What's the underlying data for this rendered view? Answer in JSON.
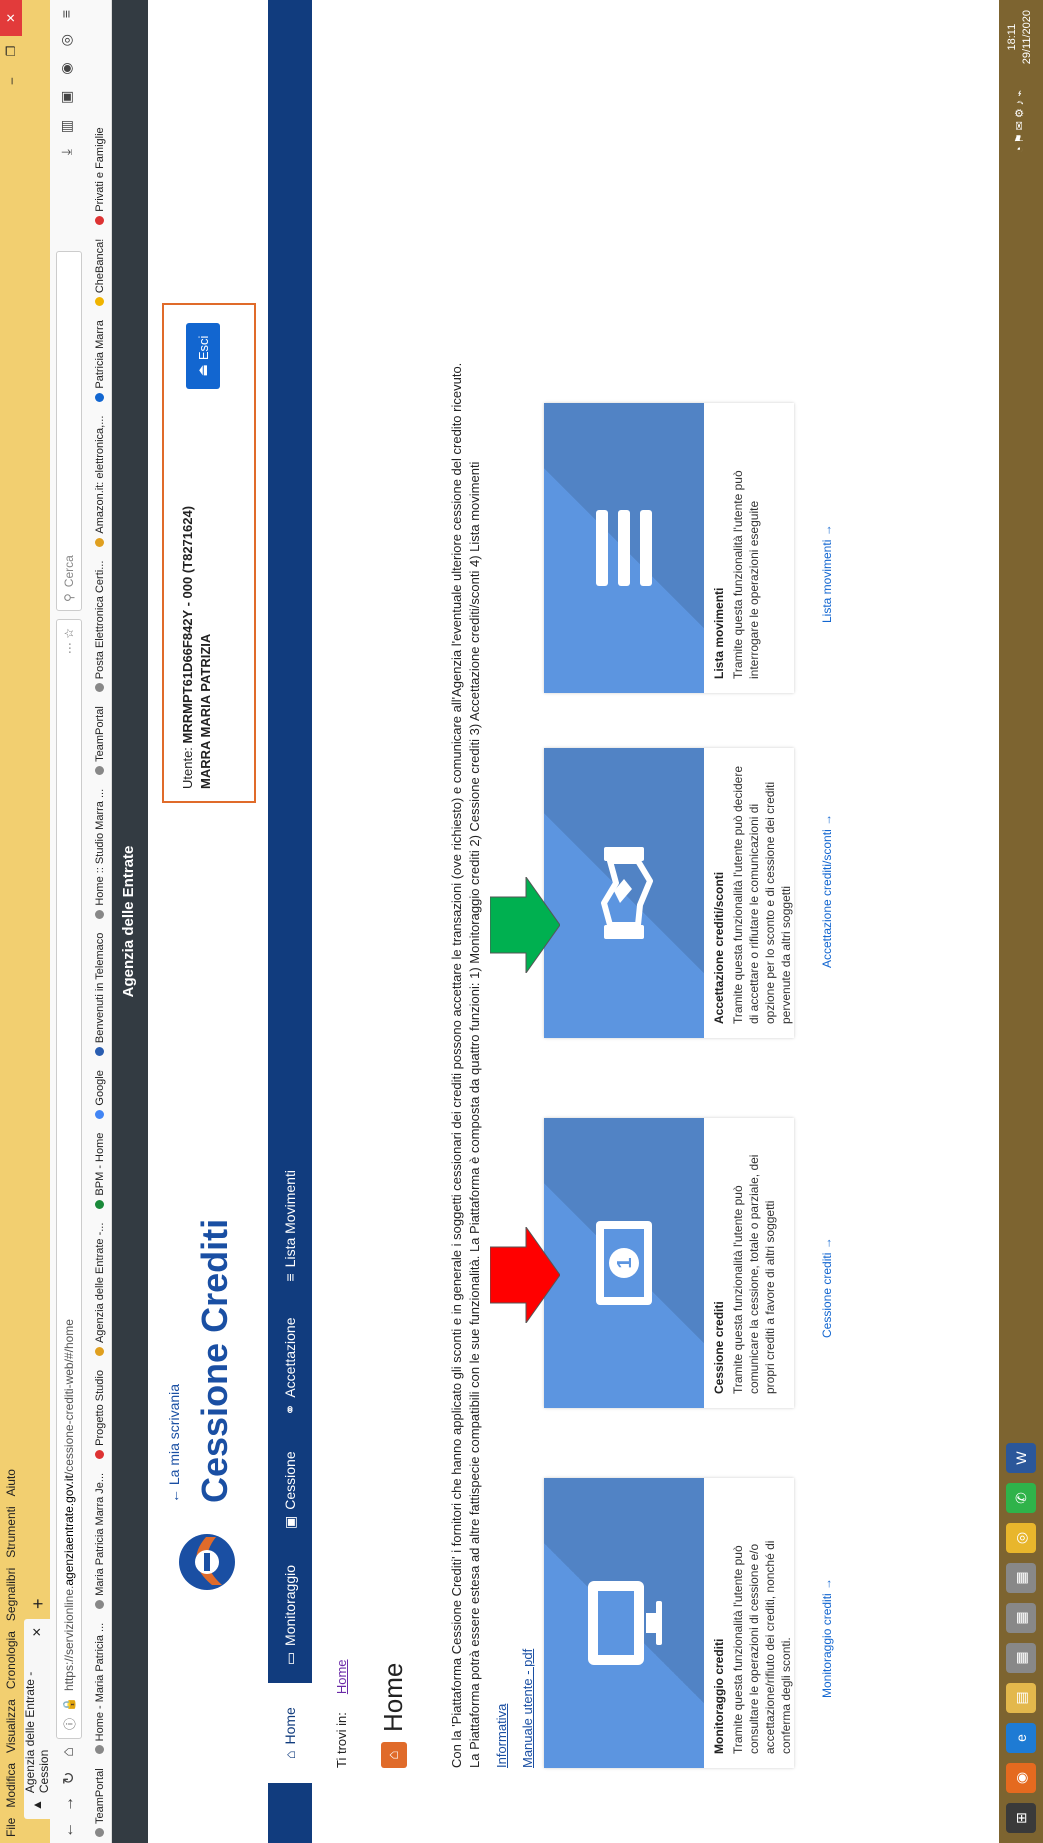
{
  "browser": {
    "menu": [
      "File",
      "Modifica",
      "Visualizza",
      "Cronologia",
      "Segnalibri",
      "Strumenti",
      "Aiuto"
    ],
    "tab_title": "Agenzia delle Entrate - Cession",
    "url_prefix": "https://servizionline.",
    "url_domain": "agenziaentrate.gov.it",
    "url_path": "/cessione-crediti-web/#/home",
    "url_dots": "··· ☆",
    "search_placeholder": "Cerca",
    "bookmarks": [
      "TeamPortal",
      "Home - Maria Patricia ...",
      "Maria Patricia Marra Je...",
      "Progetto Studio",
      "Agenzia delle Entrate -...",
      "BPM - Home",
      "Google",
      "Benvenuti in Telemaco",
      "Home :: Studio Marra ...",
      "TeamPortal",
      "Posta Elettronica Certi...",
      "Amazon.it: elettronica,...",
      "Patricia Marra",
      "CheBanca!",
      "Privati e Famiglie"
    ]
  },
  "site": {
    "top_title": "Agenzia delle Entrate",
    "back_link": "La mia scrivania",
    "title": "Cessione Crediti",
    "user_label": "Utente:",
    "user_code": "MRRMPT61D66F842Y - 000 (T8271624)",
    "user_name": "MARRA MARIA PATRIZIA",
    "logout": "Esci"
  },
  "nav": {
    "home": "Home",
    "monitoraggio": "Monitoraggio",
    "cessione": "Cessione",
    "accettazione": "Accettazione",
    "lista": "Lista Movimenti"
  },
  "content": {
    "breadcrumb_label": "Ti trovi in:",
    "breadcrumb_link": "Home",
    "heading": "Home",
    "desc1": "Con la 'Piattaforma Cessione Crediti' i fornitori che hanno applicato gli sconti e in generale i soggetti cessionari dei crediti possono accettare le transazioni (ove richiesto) e comunicare all'Agenzia l'eventuale ulteriore cessione del credito ricevuto.",
    "desc2": "La Piattaforma potrà essere estesa ad altre fattispecie compatibili con le sue funzionalità. La Piattaforma è composta da quattro funzioni: 1) Monitoraggio crediti 2) Cessione crediti 3) Accettazione crediti/sconti 4) Lista movimenti",
    "info_link": "Informativa",
    "manual_link": "Manuale utente - pdf"
  },
  "cards": [
    {
      "title": "Monitoraggio crediti",
      "desc": "Tramite questa funzionalità l'utente può consultare le operazioni di cessione e/o accettazione/rifiuto dei crediti, nonché di conferma degli sconti.",
      "link": "Monitoraggio crediti →"
    },
    {
      "title": "Cessione crediti",
      "desc": "Tramite questa funzionalità l'utente può comunicare la cessione, totale o parziale, dei propri crediti a favore di altri soggetti",
      "link": "Cessione crediti →"
    },
    {
      "title": "Accettazione crediti/sconti",
      "desc": "Tramite questa funzionalità l'utente può decidere di accettare o rifiutare le comunicazioni di opzione per lo sconto e di cessione dei crediti pervenute da altri soggetti",
      "link": "Accettazione crediti/sconti →"
    },
    {
      "title": "Lista movimenti",
      "desc": "Tramite questa funzionalità l'utente può interrogare le operazioni eseguite",
      "link": "Lista movimenti →"
    }
  ],
  "annotations": {
    "red_arrow_color": "#ff0000",
    "green_arrow_color": "#00b050"
  },
  "taskbar": {
    "time": "18:11",
    "date": "29/11/2020"
  }
}
